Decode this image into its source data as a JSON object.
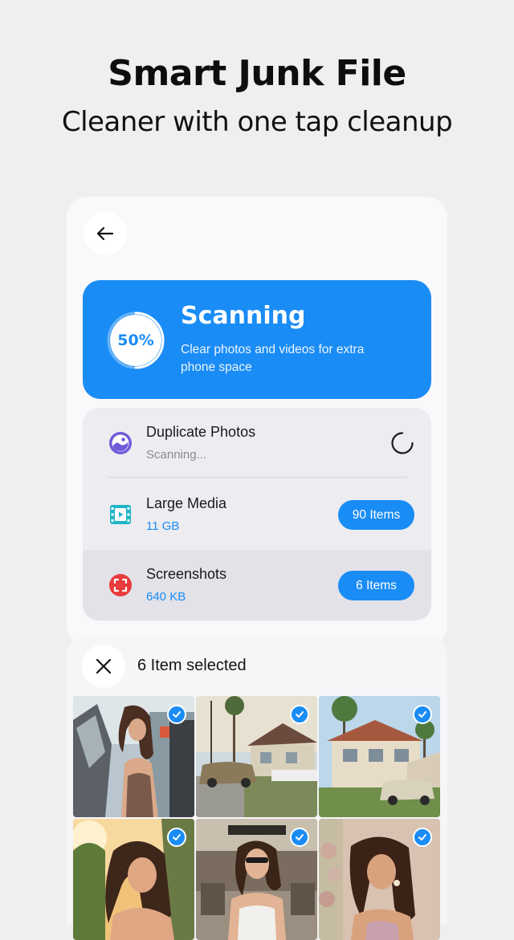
{
  "header": {
    "title": "Smart Junk File",
    "subtitle": "Cleaner with one tap cleanup"
  },
  "scan": {
    "progress_label": "50%",
    "progress_fraction": 0.5,
    "title": "Scanning",
    "description": "Clear photos and videos for extra phone space"
  },
  "categories": [
    {
      "title": "Duplicate Photos",
      "subtitle": "Scanning...",
      "icon": "duplicate-photos-icon",
      "status": "loading"
    },
    {
      "title": "Large Media",
      "subtitle": "11 GB",
      "icon": "film-icon",
      "badge": "90 Items"
    },
    {
      "title": "Screenshots",
      "subtitle": "640 KB",
      "icon": "screenshot-icon",
      "badge": "6 Items"
    }
  ],
  "selection": {
    "label": "6 Item selected"
  },
  "colors": {
    "accent": "#1a8cf5",
    "purple": "#6e5bd8",
    "teal": "#1eb5c8",
    "red": "#e83b3b"
  }
}
